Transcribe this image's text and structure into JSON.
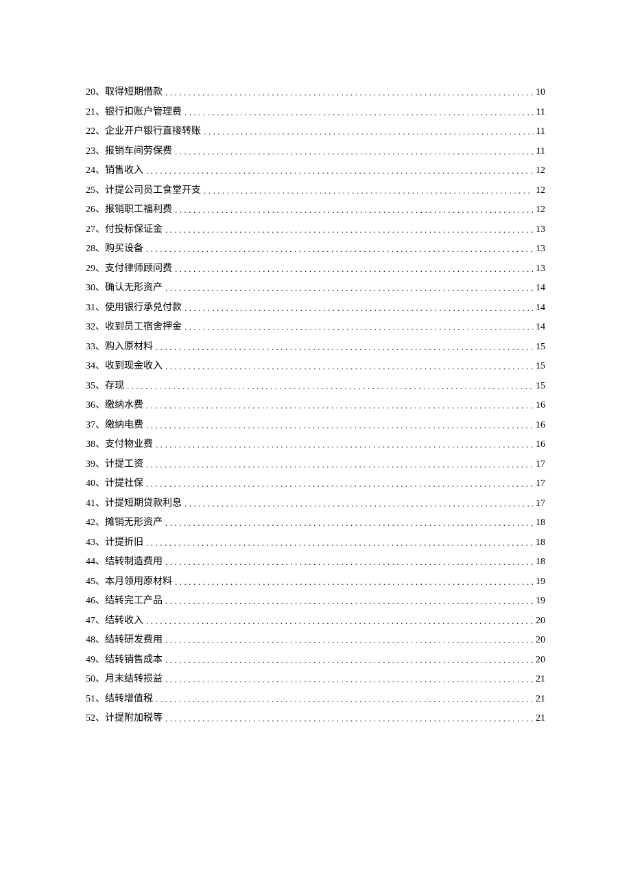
{
  "toc_entries": [
    {
      "num": "20、",
      "label": "取得短期借款",
      "page": "10"
    },
    {
      "num": "21、",
      "label": "银行扣账户管理费",
      "page": "11"
    },
    {
      "num": "22、",
      "label": "企业开户银行直接转账",
      "page": "11"
    },
    {
      "num": "23、",
      "label": "报销车间劳保费",
      "page": "11"
    },
    {
      "num": "24、",
      "label": "销售收入",
      "page": "12"
    },
    {
      "num": "25、",
      "label": "计提公司员工食堂开支",
      "page": "12"
    },
    {
      "num": "26、",
      "label": "报销职工福利费",
      "page": "12"
    },
    {
      "num": "27、",
      "label": "付投标保证金",
      "page": "13"
    },
    {
      "num": "28、",
      "label": "购买设备",
      "page": "13"
    },
    {
      "num": "29、",
      "label": "支付律师顾问费",
      "page": "13"
    },
    {
      "num": "30、",
      "label": "确认无形资产",
      "page": "14"
    },
    {
      "num": "31、",
      "label": "使用银行承兑付款",
      "page": "14"
    },
    {
      "num": "32、",
      "label": "收到员工宿舍押金",
      "page": "14"
    },
    {
      "num": "33、",
      "label": "购入原材料",
      "page": "15"
    },
    {
      "num": "34、",
      "label": "收到现金收入",
      "page": "15"
    },
    {
      "num": "35、",
      "label": "存现",
      "page": "15"
    },
    {
      "num": "36、",
      "label": "缴纳水费",
      "page": "16"
    },
    {
      "num": "37、",
      "label": "缴纳电费",
      "page": "16"
    },
    {
      "num": "38、",
      "label": "支付物业费",
      "page": "16"
    },
    {
      "num": "39、",
      "label": "计提工资",
      "page": "17"
    },
    {
      "num": "40、",
      "label": "计提社保",
      "page": "17"
    },
    {
      "num": "41、",
      "label": "计提短期贷款利息",
      "page": "17"
    },
    {
      "num": "42、",
      "label": "摊销无形资产",
      "page": "18"
    },
    {
      "num": "43、",
      "label": "计提折旧",
      "page": "18"
    },
    {
      "num": "44、",
      "label": "结转制造费用",
      "page": "18"
    },
    {
      "num": "45、",
      "label": "本月领用原材料",
      "page": "19"
    },
    {
      "num": "46、",
      "label": "结转完工产品",
      "page": "19"
    },
    {
      "num": "47、",
      "label": "结转收入",
      "page": "20"
    },
    {
      "num": "48、",
      "label": "结转研发费用",
      "page": "20"
    },
    {
      "num": "49、",
      "label": "结转销售成本",
      "page": "20"
    },
    {
      "num": "50、",
      "label": "月末结转损益",
      "page": "21"
    },
    {
      "num": "51、",
      "label": "结转增值税",
      "page": "21"
    },
    {
      "num": "52、",
      "label": "计提附加税等",
      "page": "21"
    }
  ]
}
